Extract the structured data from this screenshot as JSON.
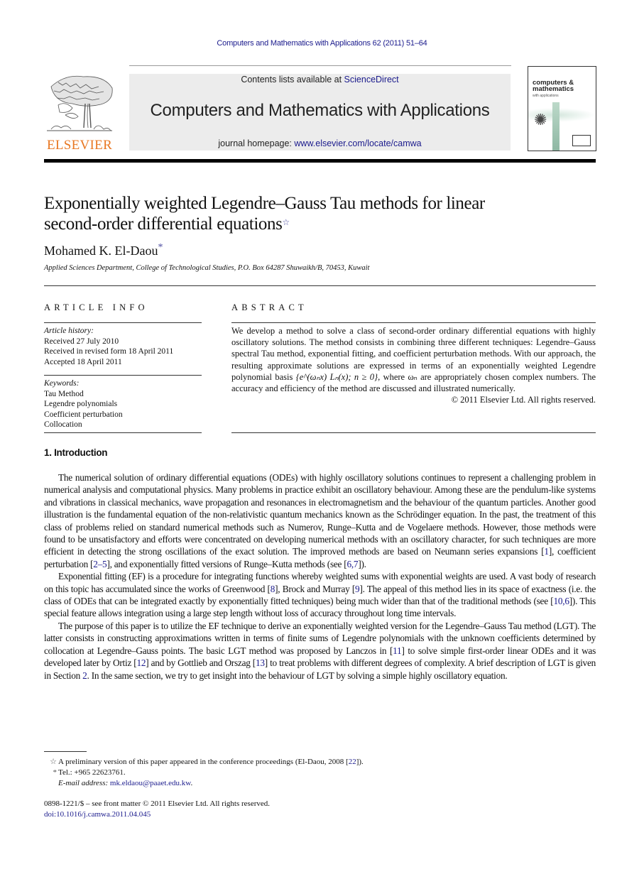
{
  "running_head": "Computers and Mathematics with Applications 62 (2011) 51–64",
  "publisher": {
    "logo_word": "ELSEVIER",
    "logo_color": "#e87722"
  },
  "banner": {
    "contents_prefix": "Contents lists available at ",
    "contents_link": "ScienceDirect",
    "journal_title": "Computers and Mathematics with Applications",
    "homepage_prefix": "journal homepage: ",
    "homepage_link": "www.elsevier.com/locate/camwa"
  },
  "cover": {
    "title_line1": "computers &",
    "title_line2": "mathematics",
    "subtitle": "with applications"
  },
  "article": {
    "title_line1": "Exponentially weighted Legendre–Gauss Tau methods for linear",
    "title_line2": "second-order differential equations",
    "title_mark": "☆",
    "author": "Mohamed K. El-Daou",
    "author_mark": "*",
    "affiliation": "Applied Sciences Department, College of Technological Studies, P.O. Box 64287 Shuwaikh/B, 70453, Kuwait"
  },
  "article_info": {
    "heading": "ARTICLE INFO",
    "history_label": "Article history:",
    "history": [
      "Received 27 July 2010",
      "Received in revised form 18 April 2011",
      "Accepted 18 April 2011"
    ],
    "keywords_label": "Keywords:",
    "keywords": [
      "Tau Method",
      "Legendre polynomials",
      "Coefficient perturbation",
      "Collocation"
    ]
  },
  "abstract": {
    "heading": "ABSTRACT",
    "text_part1": "We develop a method to solve a class of second-order ordinary differential equations with highly oscillatory solutions. The method consists in combining three different techniques: Legendre–Gauss spectral Tau method, exponential fitting, and coefficient perturbation methods. With our approach, the resulting approximate solutions are expressed in terms of an exponentially weighted Legendre polynomial basis ",
    "formula": "{e^(ωₙx) Lₙ(x); n ≥ 0}",
    "text_part2": ", where ωₙ are appropriately chosen complex numbers. The accuracy and efficiency of the method are discussed and illustrated numerically.",
    "copyright": "© 2011 Elsevier Ltd. All rights reserved."
  },
  "introduction": {
    "heading": "1.  Introduction",
    "p1": [
      "The numerical solution of ordinary differential equations (ODEs) with highly oscillatory solutions continues to represent a challenging problem in numerical analysis and computational physics. Many problems in practice exhibit an oscillatory behaviour. Among these are the pendulum-like systems and vibrations in classical mechanics, wave propagation and resonances in electromagnetism and the behaviour of the quantum particles. Another good illustration is the fundamental equation of the non-relativistic quantum mechanics known as the Schrödinger equation. In the past, the treatment of this class of problems relied on standard numerical methods such as Numerov, Runge–Kutta and de Vogelaere methods. However, those methods were found to be unsatisfactory and efforts were concentrated on developing numerical methods with an oscillatory character, for such techniques are more efficient in detecting the strong oscillations of the exact solution. The improved methods are based on Neumann series expansions [",
      "1",
      "], coefficient perturbation [",
      "2–5",
      "], and exponentially fitted versions of Runge–Kutta methods (see [",
      "6,7",
      "])."
    ],
    "p2": [
      "Exponential fitting (EF) is a procedure for integrating functions whereby weighted sums with exponential weights are used. A vast body of research on this topic has accumulated since the works of Greenwood [",
      "8",
      "], Brock and Murray [",
      "9",
      "]. The appeal of this method lies in its space of exactness (i.e. the class of ODEs that can be integrated exactly by exponentially fitted techniques) being much wider than that of the traditional methods (see [",
      "10,6",
      "]). This special feature allows integration using a large step length without loss of accuracy throughout long time intervals."
    ],
    "p3": [
      "The purpose of this paper is to utilize the EF technique to derive an exponentially weighted version for the Legendre–Gauss Tau method (LGT). The latter consists in constructing approximations written in terms of finite sums of Legendre polynomials with the unknown coefficients determined by collocation at Legendre–Gauss points. The basic LGT method was proposed by Lanczos in [",
      "11",
      "] to solve simple first-order linear ODEs and it was developed later by Ortiz [",
      "12",
      "] and by Gottlieb and Orszag [",
      "13",
      "] to treat problems with different degrees of complexity. A brief description of LGT is given in Section ",
      "2",
      ". In the same section, we try to get insight into the behaviour of LGT by solving a simple highly oscillatory equation."
    ]
  },
  "footnotes": {
    "star_mark": "☆",
    "star_text_prefix": "A preliminary version of this paper appeared in the conference proceedings (El-Daou, 2008 [",
    "star_cite": "22",
    "star_text_suffix": "]).",
    "asterisk_mark": "*",
    "tel": "Tel.: +965 22623761.",
    "email_label": "E-mail address: ",
    "email": "mk.eldaou@paaet.edu.kw",
    "email_suffix": "."
  },
  "front_matter": {
    "issn_line": "0898-1221/$ – see front matter © 2011 Elsevier Ltd. All rights reserved.",
    "doi": "doi:10.1016/j.camwa.2011.04.045"
  },
  "colors": {
    "link": "#1a1a8c",
    "banner_bg": "#ececec"
  }
}
